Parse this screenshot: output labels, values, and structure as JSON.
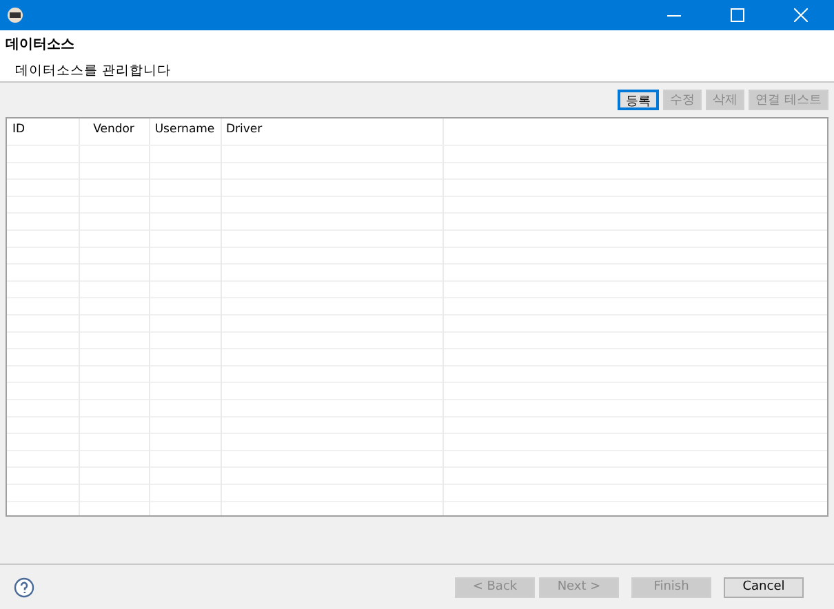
{
  "header": {
    "title": "데이터소스",
    "description": "데이터소스를 관리합니다"
  },
  "toolbar": [
    {
      "label": "등록",
      "disabled": false,
      "focused": true
    },
    {
      "label": "수정",
      "disabled": true,
      "focused": false
    },
    {
      "label": "삭제",
      "disabled": true,
      "focused": false
    },
    {
      "label": "연결 테스트",
      "disabled": true,
      "focused": false
    }
  ],
  "table": {
    "columns": [
      {
        "label": "ID"
      },
      {
        "label": "Vendor"
      },
      {
        "label": "Username"
      },
      {
        "label": "Driver"
      }
    ]
  },
  "footer": {
    "buttons": [
      {
        "label": "< Back",
        "disabled": true
      },
      {
        "label": "Next >",
        "disabled": true
      },
      {
        "label": "Finish",
        "disabled": true
      },
      {
        "label": "Cancel",
        "disabled": false
      }
    ]
  }
}
